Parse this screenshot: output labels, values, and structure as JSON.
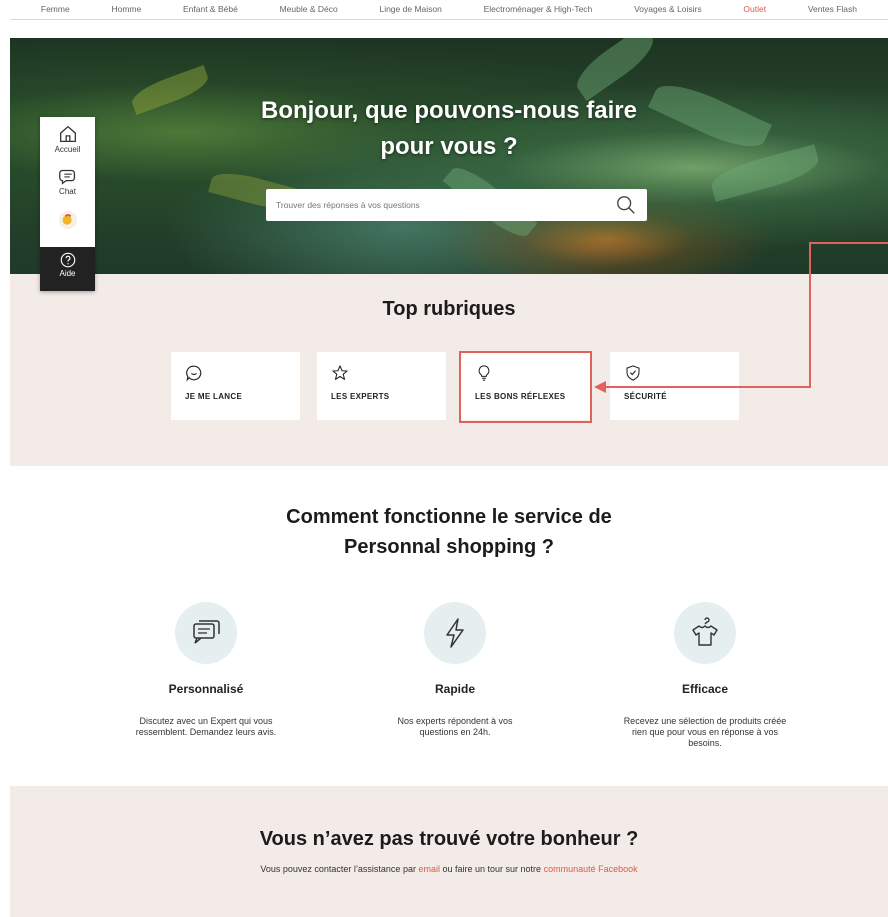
{
  "topnav": {
    "items": [
      "Femme",
      "Homme",
      "Enfant & Bébé",
      "Meuble & Déco",
      "Linge de Maison",
      "Electroménager & High-Tech",
      "Voyages & Loisirs",
      "Outlet",
      "Ventes Flash"
    ],
    "highlight_color": "#e2574c"
  },
  "hero": {
    "title_line1": "Bonjour, que pouvons-nous faire",
    "title_line2": "pour vous ?",
    "search_placeholder": "Trouver des réponses à vos questions",
    "search_icon": "search-icon"
  },
  "sidewidget": {
    "home_label": "Accueil",
    "chat_label": "Chat",
    "help_label": "Aide"
  },
  "rubriques": {
    "title": "Top rubriques",
    "cards": [
      {
        "label": "JE ME LANCE",
        "icon": "chat-smile-icon"
      },
      {
        "label": "LES EXPERTS",
        "icon": "star-icon"
      },
      {
        "label": "LES BONS RÉFLEXES",
        "icon": "lightbulb-icon"
      },
      {
        "label": "SÉCURITÉ",
        "icon": "shield-check-icon"
      }
    ],
    "highlight_color": "#e0625c"
  },
  "how": {
    "title_line1": "Comment fonctionne le service de",
    "title_line2": "Personnal shopping ?",
    "features": [
      {
        "name": "Personnalisé",
        "desc": "Discutez avec un Expert qui vous ressemblent. Demandez leurs avis.",
        "icon": "chat-bubbles-icon"
      },
      {
        "name": "Rapide",
        "desc": "Nos experts répondent à vos questions en 24h.",
        "icon": "lightning-icon"
      },
      {
        "name": "Efficace",
        "desc": "Recevez une sélection de produits créée rien que pour vous en réponse à vos besoins.",
        "icon": "tshirt-hanger-icon"
      }
    ]
  },
  "bottom": {
    "title": "Vous n’avez pas trouvé votre bonheur ?",
    "text_before": "Vous pouvez contacter l’assistance par",
    "email_link": "email",
    "text_middle": "ou faire un tour sur notre",
    "community_link": "communauté Facebook"
  }
}
